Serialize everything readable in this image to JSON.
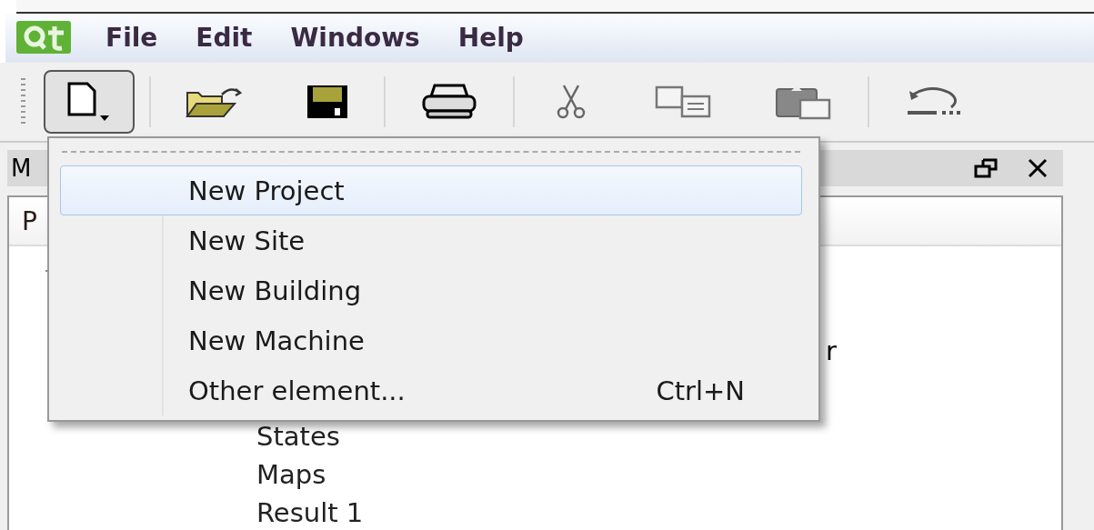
{
  "menu_bar": {
    "items": [
      {
        "label": "File"
      },
      {
        "label": "Edit"
      },
      {
        "label": "Windows"
      },
      {
        "label": "Help"
      }
    ]
  },
  "toolbar": {
    "buttons": [
      {
        "kind": "new",
        "pressed": true
      },
      {
        "kind": "separator"
      },
      {
        "kind": "open",
        "pressed": false
      },
      {
        "kind": "save",
        "pressed": false
      },
      {
        "kind": "separator"
      },
      {
        "kind": "print",
        "pressed": false
      },
      {
        "kind": "separator"
      },
      {
        "kind": "cut",
        "pressed": false
      },
      {
        "kind": "copy",
        "pressed": false
      },
      {
        "kind": "paste",
        "pressed": false
      },
      {
        "kind": "separator"
      },
      {
        "kind": "undo",
        "pressed": false
      }
    ]
  },
  "dock": {
    "title": "M",
    "column_header": "P",
    "covered_text": "r",
    "tree_items": [
      {
        "label": "States"
      },
      {
        "label": "Maps"
      },
      {
        "label": "Result 1"
      }
    ]
  },
  "popup_menu": {
    "items": [
      {
        "label": "New Project",
        "selected": true
      },
      {
        "label": "New Site",
        "selected": false
      },
      {
        "label": "New Building",
        "selected": false
      },
      {
        "label": "New Machine",
        "selected": false
      },
      {
        "label": "Other element...",
        "shortcut": "Ctrl+N",
        "selected": false
      }
    ]
  }
}
